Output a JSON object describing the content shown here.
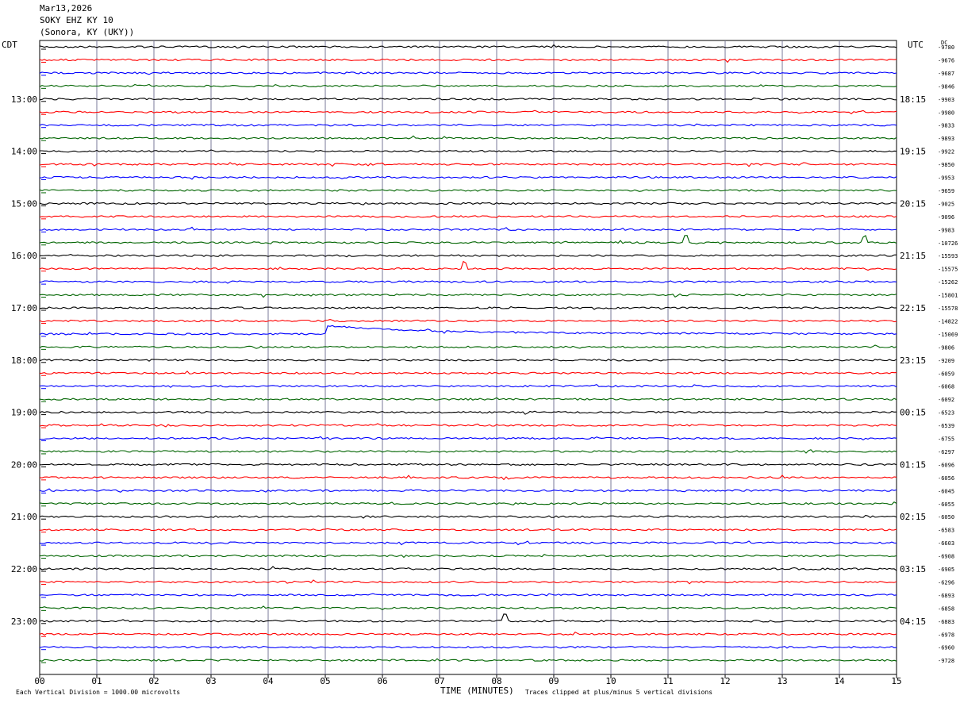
{
  "header": {
    "date": "Mar13,2026",
    "station": "SOKY EHZ KY 10",
    "location": "(Sonora, KY (UKY))"
  },
  "left_axis_title": "CDT",
  "right_axis_title": "UTC",
  "dc_label": "DC",
  "colors": {
    "black": "#000000",
    "red": "#ff0000",
    "blue": "#0000ff",
    "green": "#006400",
    "grid": "#7a7a9a"
  },
  "chart_data": {
    "type": "line",
    "subtype": "helicorder",
    "xlabel": "TIME (MINUTES)",
    "x_ticks": [
      "00",
      "01",
      "02",
      "03",
      "04",
      "05",
      "06",
      "07",
      "08",
      "09",
      "10",
      "11",
      "12",
      "13",
      "14",
      "15"
    ],
    "xlim": [
      0,
      15
    ],
    "trace_colors": [
      "black",
      "red",
      "blue",
      "green"
    ],
    "left_time_labels": [
      "13:00",
      "14:00",
      "15:00",
      "16:00",
      "17:00",
      "18:00",
      "19:00",
      "20:00",
      "21:00",
      "22:00",
      "23:00"
    ],
    "right_time_labels": [
      "18:15",
      "19:15",
      "20:15",
      "21:15",
      "22:15",
      "23:15",
      "00:15",
      "01:15",
      "02:15",
      "03:15",
      "04:15"
    ],
    "first_labeled_trace_index": 4,
    "traces_per_hour": 4,
    "dc_offsets": [
      "-9780",
      "-9676",
      "-9687",
      "-9846",
      "-9903",
      "-9980",
      "-9833",
      "-9893",
      "-9922",
      "-9850",
      "-9953",
      "-9659",
      "-9025",
      "-9096",
      "-9983",
      "-10726",
      "-15593",
      "-15575",
      "-15262",
      "-15801",
      "-15578",
      "-14822",
      "-15069",
      "-9806",
      "-9209",
      "-6059",
      "-6068",
      "-6092",
      "-6523",
      "-6539",
      "-6755",
      "-6297",
      "-6096",
      "-6056",
      "-6045",
      "-6055",
      "-6050",
      "-6583",
      "-6603",
      "-6908",
      "-6905",
      "-6296",
      "-6893",
      "-6858",
      "-6883",
      "-6978",
      "-6960",
      "-9728"
    ],
    "events": [
      {
        "trace": 22,
        "minute": 5.02,
        "kind": "offset-decay"
      },
      {
        "trace": 44,
        "minute": 8.15,
        "kind": "spike"
      },
      {
        "trace": 15,
        "minute": 11.3,
        "kind": "spike"
      },
      {
        "trace": 15,
        "minute": 14.45,
        "kind": "spike"
      },
      {
        "trace": 17,
        "minute": 7.45,
        "kind": "spike"
      }
    ]
  },
  "footer": {
    "scale_note": "Each Vertical Division = 1000.00 microvolts",
    "clip_note": "Traces clipped at plus/minus 5 vertical divisions"
  }
}
